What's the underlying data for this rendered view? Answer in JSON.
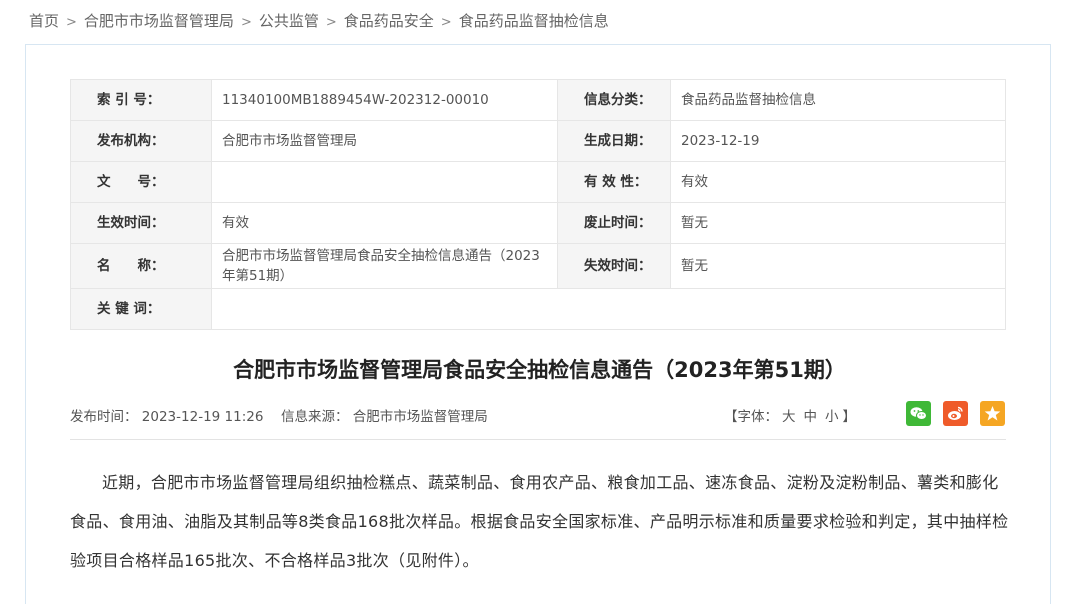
{
  "breadcrumb": {
    "items": [
      "首页",
      "合肥市市场监督管理局",
      "公共监管",
      "食品药品安全",
      "食品药品监督抽检信息"
    ],
    "separator": ">"
  },
  "meta": {
    "index_label": "索 引 号：",
    "index_value": "11340100MB1889454W-202312-00010",
    "category_label": "信息分类：",
    "category_value": "食品药品监督抽检信息",
    "publisher_label": "发布机构：",
    "publisher_value": "合肥市市场监督管理局",
    "created_label": "生成日期：",
    "created_value": "2023-12-19",
    "docno_label": "文　　号：",
    "docno_value": "",
    "validity_label": "有 效 性：",
    "validity_value": "有效",
    "effective_label": "生效时间：",
    "effective_value": "有效",
    "abolished_label": "废止时间：",
    "abolished_value": "暂无",
    "name_label": "名　　称：",
    "name_value": "合肥市市场监督管理局食品安全抽检信息通告（2023年第51期）",
    "expire_label": "失效时间：",
    "expire_value": "暂无",
    "keywords_label": "关 键 词：",
    "keywords_value": ""
  },
  "article": {
    "title": "合肥市市场监督管理局食品安全抽检信息通告（2023年第51期）",
    "pub_time": "发布时间： 2023-12-19 11:26",
    "source": "信息来源： 合肥市市场监督管理局",
    "font_label_open": "【字体：",
    "font_large": "大",
    "font_medium": "中",
    "font_small": "小",
    "font_label_close": "】",
    "body": "近期，合肥市市场监督管理局组织抽检糕点、蔬菜制品、食用农产品、粮食加工品、速冻食品、淀粉及淀粉制品、薯类和膨化食品、食用油、油脂及其制品等8类食品168批次样品。根据食品安全国家标准、产品明示标准和质量要求检验和判定，其中抽样检验项目合格样品165批次、不合格样品3批次（见附件）。"
  },
  "share": {
    "wechat_color": "#3fb837",
    "weibo_color": "#ef5b2a",
    "favorite_color": "#f5a623"
  }
}
